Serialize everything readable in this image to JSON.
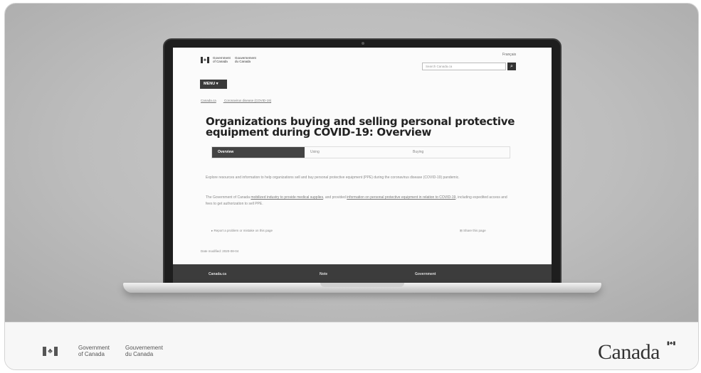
{
  "screen": {
    "header": {
      "sig_en_1": "Government",
      "sig_en_2": "of Canada",
      "sig_fr_1": "Gouvernement",
      "sig_fr_2": "du Canada",
      "lang_link": "Français",
      "search_placeholder": "Search Canada.ca",
      "search_icon": "search-icon"
    },
    "menu_label": "MENU ▾",
    "breadcrumbs": [
      "Canada.ca",
      "Coronavirus disease (COVID-19)"
    ],
    "title": "Organizations buying and selling personal protective equipment during COVID-19: Overview",
    "tabs": [
      {
        "label": "Overview",
        "active": true
      },
      {
        "label": "Using",
        "active": false
      },
      {
        "label": "Buying",
        "active": false
      }
    ],
    "para1": "Explore resources and information to help organizations sell and buy personal protective equipment (PPE) during the coronavirus disease (COVID-19) pandemic.",
    "para2_a": "The Government of Canada ",
    "para2_link1": "mobilized industry to provide medical supplies",
    "para2_b": ", and provided ",
    "para2_link2": "information on personal protective equipment in relation to COVID-19",
    "para2_c": ", including expedited access and fees to get authorization to sell PPE.",
    "report_link": "Report a problem or mistake on this page",
    "share_link": "Share this page",
    "date_modified": "Date modified: 2020-08-04",
    "footer": {
      "col1": "Canada.ca",
      "col2": "Note",
      "col3": "Government"
    }
  },
  "signature_bar": {
    "en_1": "Government",
    "en_2": "of Canada",
    "fr_1": "Gouvernement",
    "fr_2": "du Canada",
    "wordmark": "Canada"
  },
  "colors": {
    "background": "#bdbdbd",
    "screen_bg": "#fbfbfb",
    "dark_bar": "#3c3c3c"
  }
}
